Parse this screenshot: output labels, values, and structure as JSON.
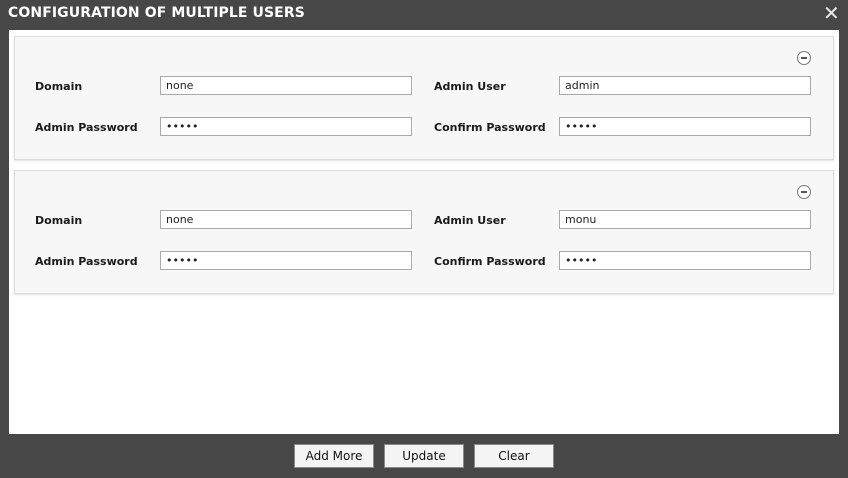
{
  "dialog": {
    "title": "CONFIGURATION OF MULTIPLE USERS",
    "close_icon": "close-icon"
  },
  "users": [
    {
      "domain_label": "Domain",
      "domain_value": "none",
      "admin_user_label": "Admin User",
      "admin_user_value": "admin",
      "admin_password_label": "Admin Password",
      "admin_password_value": "•••••",
      "confirm_password_label": "Confirm Password",
      "confirm_password_value": "•••••",
      "remove_icon": "minus-circle-icon"
    },
    {
      "domain_label": "Domain",
      "domain_value": "none",
      "admin_user_label": "Admin User",
      "admin_user_value": "monu",
      "admin_password_label": "Admin Password",
      "admin_password_value": "•••••",
      "confirm_password_label": "Confirm Password",
      "confirm_password_value": "•••••",
      "remove_icon": "minus-circle-icon"
    }
  ],
  "footer": {
    "add_more_label": "Add More",
    "update_label": "Update",
    "clear_label": "Clear"
  },
  "colors": {
    "frame": "#474747",
    "panel": "#ffffff",
    "card": "#f7f7f7"
  }
}
